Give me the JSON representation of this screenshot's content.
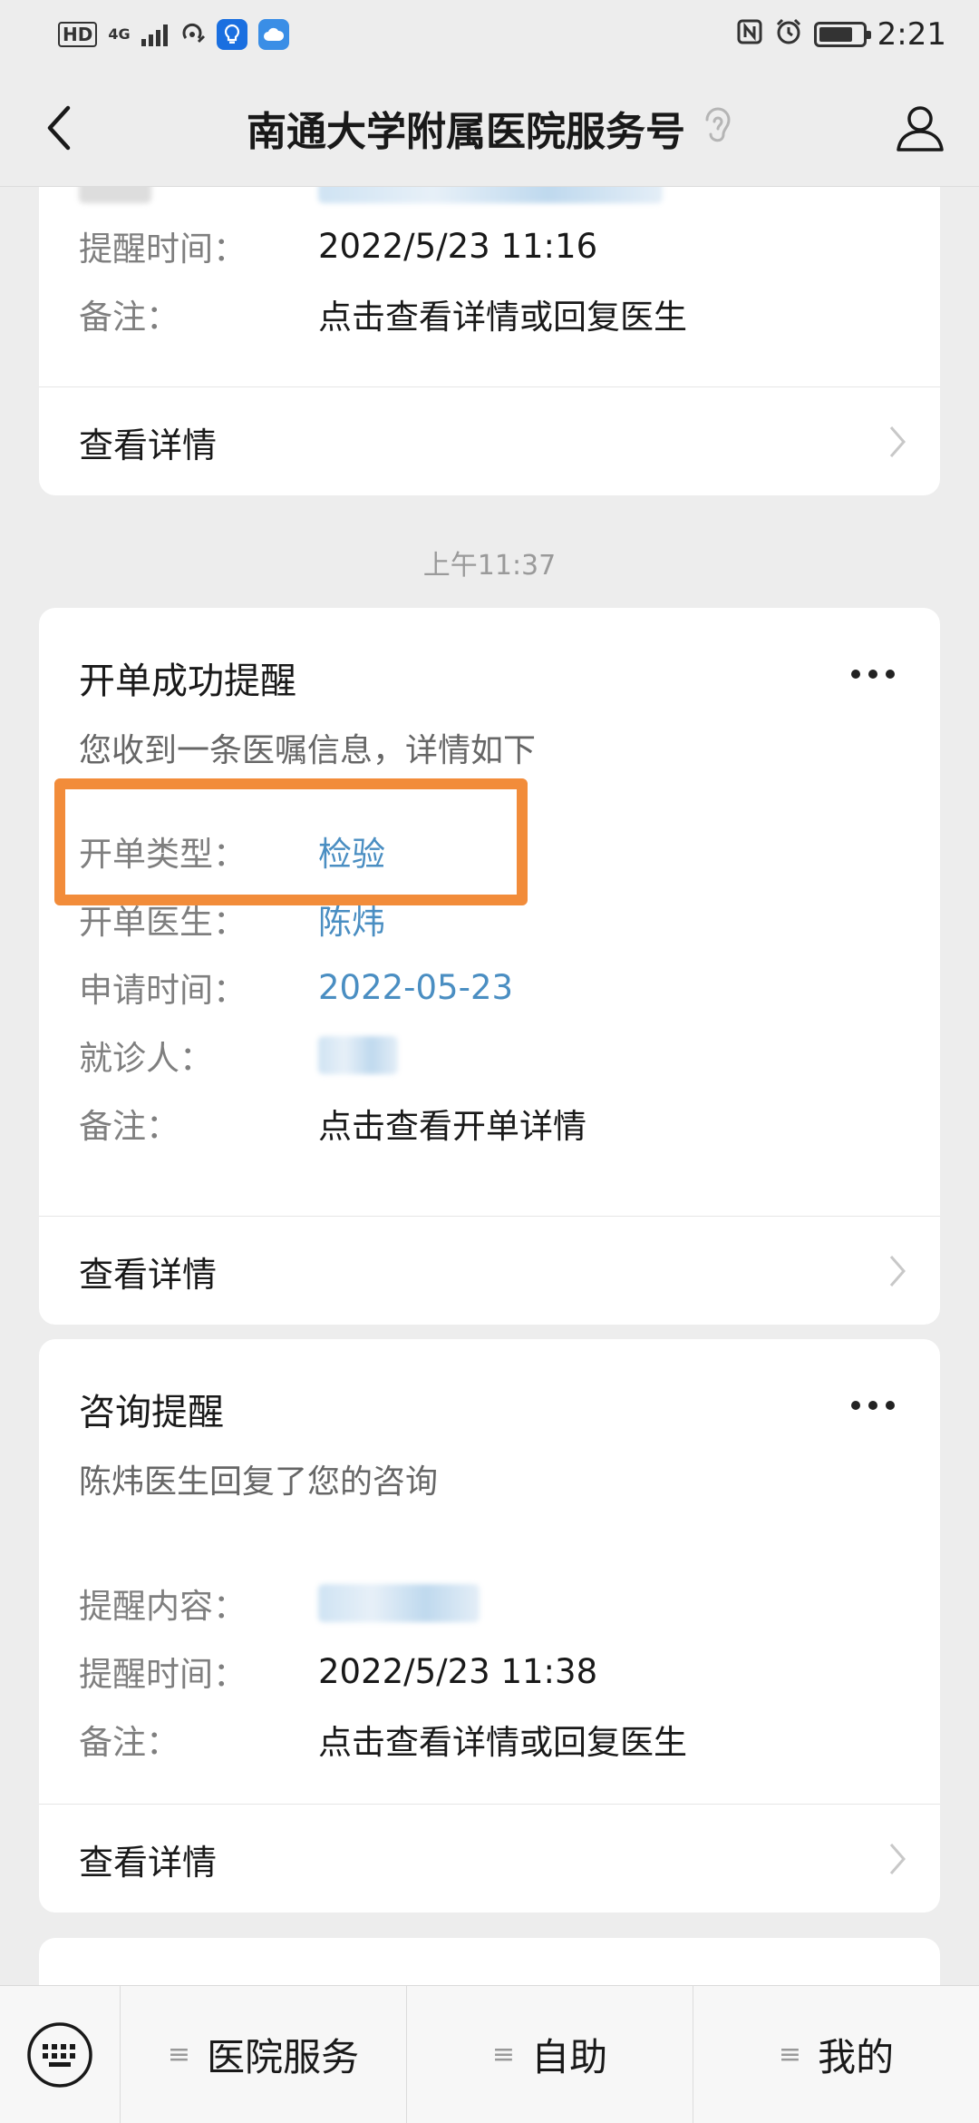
{
  "status_bar": {
    "hd": "HD",
    "network": "4G",
    "time": "2:21",
    "battery_level": 0.8
  },
  "nav": {
    "title": "南通大学附属医院服务号"
  },
  "cards": {
    "first": {
      "remind_time_label": "提醒时间：",
      "remind_time_value": "2022/5/23 11:16",
      "note_label": "备注：",
      "note_value": "点击查看详情或回复医生",
      "detail_label": "查看详情"
    },
    "order": {
      "timestamp": "上午11:37",
      "title": "开单成功提醒",
      "subtitle": "您收到一条医嘱信息，详情如下",
      "type_label": "开单类型：",
      "type_value": "检验",
      "doctor_label": "开单医生：",
      "doctor_value": "陈炜",
      "apply_time_label": "申请时间：",
      "apply_time_value": "2022-05-23",
      "patient_label": "就诊人：",
      "note_label": "备注：",
      "note_value": "点击查看开单详情",
      "detail_label": "查看详情"
    },
    "consult": {
      "title": "咨询提醒",
      "subtitle": "陈炜医生回复了您的咨询",
      "content_label": "提醒内容：",
      "time_label": "提醒时间：",
      "time_value": "2022/5/23 11:38",
      "note_label": "备注：",
      "note_value": "点击查看详情或回复医生",
      "detail_label": "查看详情"
    }
  },
  "bottom_menu": {
    "items": [
      "医院服务",
      "自助",
      "我的"
    ]
  },
  "colors": {
    "link": "#4a8ec2",
    "highlight": "#f28c3a",
    "background": "#ededed"
  }
}
